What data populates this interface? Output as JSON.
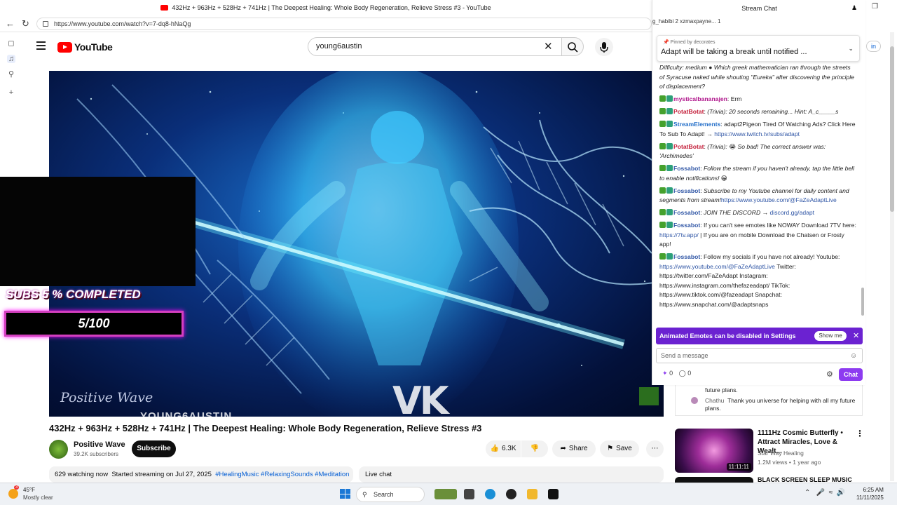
{
  "window": {
    "title": "432Hz + 963Hz + 528Hz + 741Hz | The Deepest Healing: Whole Body Regeneration, Relieve Stress #3 - YouTube"
  },
  "browser": {
    "url": "https://www.youtube.com/watch?v=7-dq8-hNaQg"
  },
  "youtube": {
    "logo": "YouTube",
    "search_value": "young6austin",
    "video": {
      "sub_goal_label": "SUBS 5 % COMPLETED",
      "sub_goal_count": "5/100",
      "sub_goal_progress": 0.05,
      "watermark": "Positive Wave",
      "overlay_text": "YOUNG6AUSTIN",
      "vk_logo": "VK"
    },
    "title": "432Hz + 963Hz + 528Hz + 741Hz | The Deepest Healing: Whole Body Regeneration, Relieve Stress #3",
    "channel": {
      "name": "Positive Wave",
      "subscribers": "39.2K subscribers",
      "subscribe_label": "Subscribe"
    },
    "actions": {
      "likes": "6.3K",
      "share": "Share",
      "save": "Save"
    },
    "info": {
      "watching": "629 watching now",
      "started": "Started streaming on Jul 27, 2025",
      "tags": "#HealingMusic #RelaxingSounds #Meditation"
    },
    "live_chat_label": "Live chat",
    "chat_peek": [
      {
        "user": "",
        "text": "future plans."
      },
      {
        "user": "Chathu",
        "text": "Thank you universe for helping with all my future plans."
      }
    ],
    "recommendations": [
      {
        "title": "1111Hz Cosmic Butterfly • Attract Miracles, Love & Wealt...",
        "channel": "Star Way Healing",
        "meta": "1.2M views • 1 year ago",
        "duration": "11:11:11"
      },
      {
        "title": "BLACK SCREEN SLEEP MUSIC",
        "channel": "",
        "meta": "",
        "duration": ""
      }
    ],
    "signin_hint": "in"
  },
  "twitch": {
    "header": "Stream Chat",
    "stats": "g_habibi   2   xzmaxpayne...   1",
    "pinned_by_label": "Pinned by",
    "pinned_by": "decorates",
    "pinned_text": "Adapt will be taking a break until notified ...",
    "messages": [
      {
        "user": "",
        "text": "Difficulty: medium ● Which greek mathematician ran through the streets of Syracuse naked while shouting \"Eureka\" after discovering the principle of displacement?",
        "italic": true
      },
      {
        "user": "mysticalbananajen",
        "text": "Erm",
        "color": "#b0168c"
      },
      {
        "user": "PotatBotat",
        "text": "(Trivia): 20 seconds remaining... Hint: A_c_____s",
        "color": "#c41f3a",
        "italic": true
      },
      {
        "user": "StreamElements",
        "text": "adapt2Pigeon Tired Of Watching Ads? Click Here To Sub To Adapt! → ",
        "link": "https://www.twitch.tv/subs/adapt",
        "color": "#2670c9"
      },
      {
        "user": "PotatBotat",
        "text": "(Trivia): 😭 So bad! The correct answer was: 'Archimedes'",
        "color": "#c41f3a",
        "italic": true
      },
      {
        "user": "Fossabot",
        "text": "Follow the stream if you haven't already, tap the little bell to enable notifications! 😁",
        "color": "#3157a6",
        "italic": true
      },
      {
        "user": "Fossabot",
        "text": "Subscribe to my Youtube channel for daily content and segments from stream!",
        "link": "https://www.youtube.com/@FaZeAdaptLive",
        "color": "#3157a6",
        "italic": true
      },
      {
        "user": "Fossabot",
        "text": "JOIN THE DISCORD → ",
        "link": "discord.gg/adapt",
        "color": "#3157a6",
        "italic": true
      },
      {
        "user": "Fossabot",
        "text": "If you can't see emotes like NOWAY Download 7TV here: ",
        "link": "https://7tv.app/",
        "tail": " | If you are on mobile Download the Chatsen or Frosty app!",
        "color": "#3157a6"
      },
      {
        "user": "Fossabot",
        "text": "Follow my socials if you have not already! Youtube: ",
        "link": "https://www.youtube.com/@FaZeAdaptLive",
        "tail": " Twitter: https://twitter.com/FaZeAdapt Instagram: https://www.instagram.com/thefazeadapt/ TikTok: https://www.tiktok.com/@fazeadapt Snapchat: https://www.snapchat.com/@adaptsnaps",
        "color": "#3157a6"
      }
    ],
    "emote_notice": "Animated Emotes can be disabled in Settings",
    "show_me": "Show me",
    "send_placeholder": "Send a message",
    "points_a": "0",
    "points_b": "0",
    "chat_button": "Chat"
  },
  "taskbar": {
    "weather_temp": "45°F",
    "weather_desc": "Mostly clear",
    "weather_badge": "3",
    "search_label": "Search",
    "time": "6:25 AM",
    "date": "11/11/2025"
  },
  "colors": {
    "youtube_red": "#ff0000",
    "twitch_purple": "#8d3bf0",
    "goal_pink": "#d33fbf"
  }
}
